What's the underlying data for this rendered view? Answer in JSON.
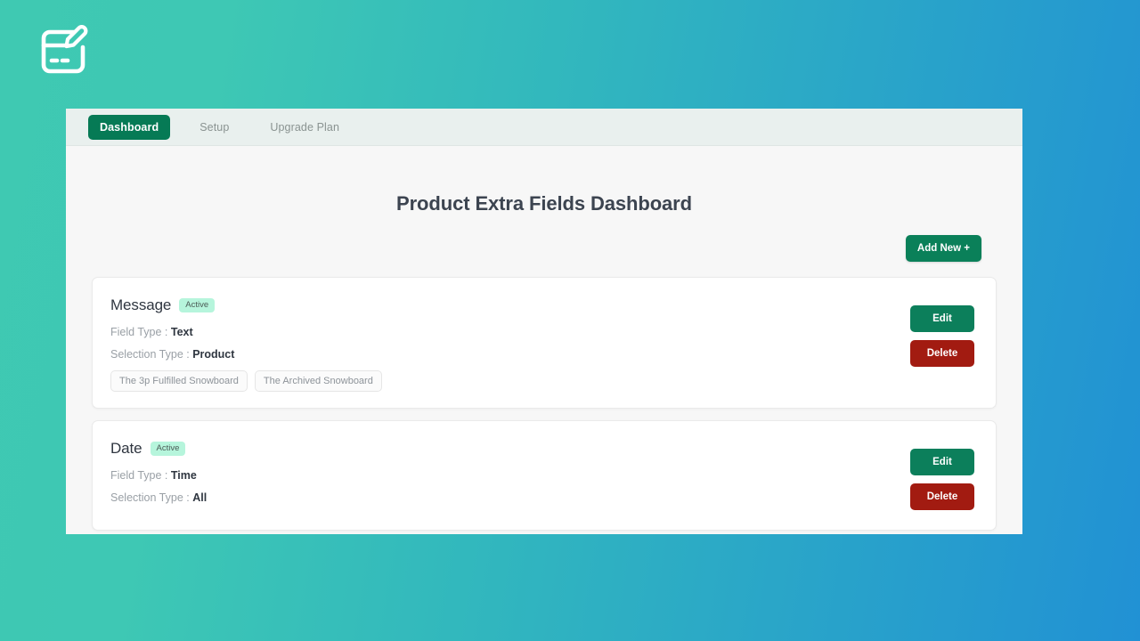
{
  "app": {
    "logo_icon": "form-edit-pencil-icon",
    "background_gradient_from": "#3fc9b2",
    "background_gradient_to": "#2191d4"
  },
  "nav": {
    "items": [
      {
        "label": "Dashboard",
        "active": true
      },
      {
        "label": "Setup",
        "active": false
      },
      {
        "label": "Upgrade Plan",
        "active": false
      }
    ]
  },
  "main": {
    "title": "Product Extra Fields Dashboard",
    "add_new_label": "Add New +"
  },
  "labels": {
    "field_type": "Field Type :",
    "selection_type": "Selection Type :",
    "edit": "Edit",
    "delete": "Delete"
  },
  "colors": {
    "primary_green": "#0a8059",
    "nav_active_green": "#067a55",
    "delete_red": "#a21b11",
    "badge_bg": "#b6f5dc",
    "panel_bg": "#f7f7f7",
    "navbar_bg": "#e9f0ee"
  },
  "cards": [
    {
      "title": "Message",
      "status": "Active",
      "field_type": "Text",
      "selection_type": "Product",
      "products": [
        "The 3p Fulfilled Snowboard",
        "The Archived Snowboard"
      ]
    },
    {
      "title": "Date",
      "status": "Active",
      "field_type": "Time",
      "selection_type": "All",
      "products": []
    }
  ]
}
